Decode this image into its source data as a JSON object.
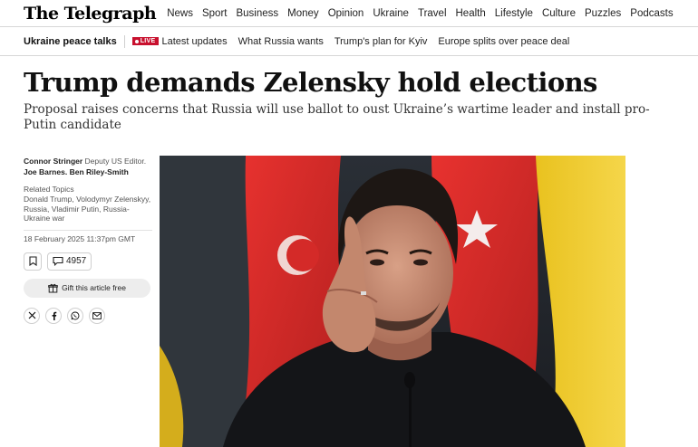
{
  "site": {
    "logo": "The Telegraph"
  },
  "topnav": {
    "items": [
      "News",
      "Sport",
      "Business",
      "Money",
      "Opinion",
      "Ukraine",
      "Travel",
      "Health",
      "Lifestyle",
      "Culture",
      "Puzzles",
      "Podcasts"
    ]
  },
  "subnav": {
    "section": "Ukraine peace talks",
    "live_badge": "LIVE",
    "live_label": "Latest updates",
    "links": [
      "What Russia wants",
      "Trump's plan for Kyiv",
      "Europe splits over peace deal"
    ]
  },
  "article": {
    "headline": "Trump demands Zelensky hold elections",
    "standfirst": "Proposal raises concerns that Russia will use ballot to oust Ukraine’s wartime leader and install pro-Putin candidate"
  },
  "byline": {
    "author1_name": "Connor Stringer",
    "author1_role": "Deputy US Editor.",
    "author2_name": "Joe Barnes.",
    "author3_name": "Ben Riley-Smith"
  },
  "topics": {
    "title": "Related Topics",
    "list": "Donald Trump, Volodymyr Zelenskyy, Russia, Vladimir Putin, Russia-Ukraine war"
  },
  "meta": {
    "date": "18 February 2025 11:37pm GMT"
  },
  "actions": {
    "comments_count": "4957",
    "gift_label": "Gift this article free"
  },
  "icons": {
    "bookmark": "bookmark-icon",
    "comment": "comment-icon",
    "gift": "gift-icon",
    "x": "x-logo-icon",
    "facebook": "facebook-icon",
    "whatsapp": "whatsapp-icon",
    "email": "email-icon"
  },
  "colors": {
    "live_red": "#c8102e",
    "text": "#111111",
    "muted": "#555555",
    "gift_bg": "#ededed"
  }
}
